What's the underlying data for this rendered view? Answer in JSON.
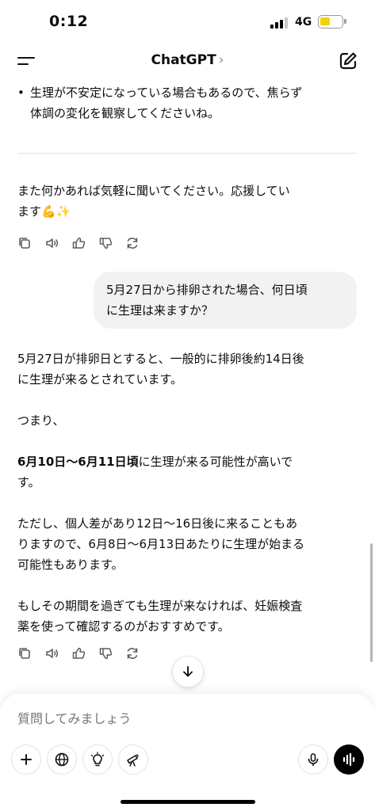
{
  "status_bar": {
    "time": "0:12",
    "network": "4G",
    "battery_color": "#f5d100"
  },
  "nav": {
    "title": "ChatGPT",
    "title_chevron": "›",
    "menu_icon": "menu-icon",
    "compose_icon": "compose-icon"
  },
  "chat": {
    "assistant_prev": {
      "bullet_line1": "生理が不安定になっている場合もあるので、焦らず",
      "bullet_line2": "体調の変化を観察してくださいね。",
      "closing_line1": "また何かあれば気軽に聞いてください。応援してい",
      "closing_line2": "ます💪✨"
    },
    "user_message": {
      "line1": "5月27日から排卵された場合、何日頃",
      "line2": "に生理は来ますか？"
    },
    "assistant_reply": {
      "p1_line1": "5月27日が排卵日とすると、一般的に排卵後約14日後",
      "p1_line2": "に生理が来るとされています。",
      "p2": "つまり、",
      "p3_bold": "6月10日〜6月11日頃",
      "p3_rest": "に生理が来る可能性が高いで",
      "p3_line2": "す。",
      "p4_line1": "ただし、個人差があり12日〜16日後に来ることもあ",
      "p4_line2": "りますので、6月8日〜6月13日あたりに生理が始まる",
      "p4_line3": "可能性もあります。",
      "p5_line1": "もしその期間を過ぎても生理が来なければ、妊娠検査",
      "p5_line2": "薬を使って確認するのがおすすめです。"
    },
    "action_icons": [
      "copy-icon",
      "speaker-icon",
      "thumbs-up-icon",
      "thumbs-down-icon",
      "regenerate-icon"
    ]
  },
  "composer": {
    "placeholder": "質問してみましょう",
    "tools": [
      "plus-icon",
      "globe-icon",
      "lightbulb-icon",
      "telescope-icon",
      "microphone-icon",
      "voice-mode-icon"
    ]
  }
}
